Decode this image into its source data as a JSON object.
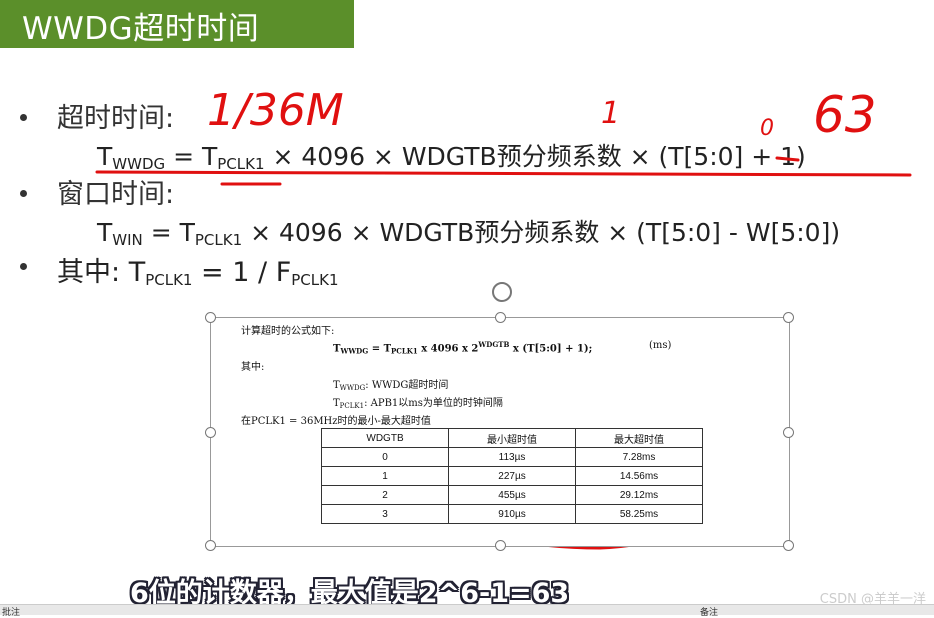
{
  "slide": {
    "title": "WWDG超时时间",
    "bullets": {
      "b1_label": "超时时间:",
      "b1_formula_a": "T",
      "b1_formula_a_sub": "WWDG",
      "b1_formula_b": " = T",
      "b1_formula_b_sub": "PCLK1",
      "b1_formula_c": " × 4096 × WDGTB预分频系数 × (T[5:0] + 1)",
      "b2_label": "窗口时间:",
      "b2_formula_a": "T",
      "b2_formula_a_sub": "WIN",
      "b2_formula_b": " = T",
      "b2_formula_b_sub": "PCLK1",
      "b2_formula_c": " × 4096 × WDGTB预分频系数 × (T[5:0] - W[5:0])",
      "b3_label": "其中:",
      "b3_formula_a": "T",
      "b3_formula_a_sub": "PCLK1",
      "b3_formula_b": " = 1 / F",
      "b3_formula_b_sub": "PCLK1"
    },
    "annotations": {
      "a1": "1/36M",
      "a2": "1",
      "a3": "0",
      "a4": "63",
      "a5": "1"
    }
  },
  "embedded": {
    "heading": "计算超时的公式如下:",
    "formula_a": "T",
    "formula_a_sub": "WWDG",
    "formula_b": " = T",
    "formula_b_sub": "PCLK1",
    "formula_c": " x 4096 x 2",
    "formula_c_sup": "WDGTB",
    "formula_d": " x (T[5:0] + 1);",
    "unit": "(ms)",
    "where": "其中:",
    "def1_a": "T",
    "def1_sub": "WWDG",
    "def1_b": ":  WWDG超时时间",
    "def2_a": "T",
    "def2_sub": "PCLK1",
    "def2_b": ":  APB1以ms为单位的时钟间隔",
    "table_caption": "在PCLK1 = 36MHz时的最小-最大超时值",
    "table": {
      "headers": [
        "WDGTB",
        "最小超时值",
        "最大超时值"
      ],
      "rows": [
        [
          "0",
          "113µs",
          "7.28ms"
        ],
        [
          "1",
          "227µs",
          "14.56ms"
        ],
        [
          "2",
          "455µs",
          "29.12ms"
        ],
        [
          "3",
          "910µs",
          "58.25ms"
        ]
      ]
    }
  },
  "subtitle": "6位的计数器，最大值是2^6-1=63",
  "watermark": "CSDN @羊羊一洋",
  "toolbar": {
    "left": "批注",
    "right": "备注"
  },
  "colors": {
    "title_bg": "#5b8f2a",
    "annotation": "#e01010"
  }
}
